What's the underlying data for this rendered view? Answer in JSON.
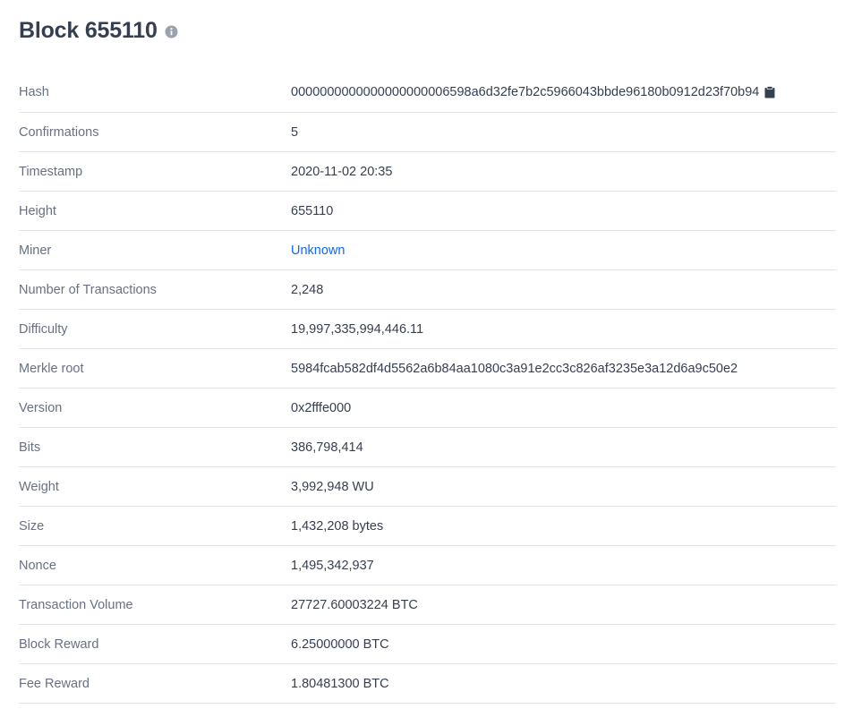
{
  "block": {
    "title": "Block 655110"
  },
  "details": [
    {
      "label": "Hash",
      "value": "0000000000000000000006598a6d32fe7b2c5966043bbde96180b0912d23f70b94"
    },
    {
      "label": "Confirmations",
      "value": "5"
    },
    {
      "label": "Timestamp",
      "value": "2020-11-02 20:35"
    },
    {
      "label": "Height",
      "value": "655110"
    },
    {
      "label": "Miner",
      "value": "Unknown"
    },
    {
      "label": "Number of Transactions",
      "value": "2,248"
    },
    {
      "label": "Difficulty",
      "value": "19,997,335,994,446.11"
    },
    {
      "label": "Merkle root",
      "value": "5984fcab582df4d5562a6b84aa1080c3a91e2cc3c826af3235e3a12d6a9c50e2"
    },
    {
      "label": "Version",
      "value": "0x2fffe000"
    },
    {
      "label": "Bits",
      "value": "386,798,414"
    },
    {
      "label": "Weight",
      "value": "3,992,948 WU"
    },
    {
      "label": "Size",
      "value": "1,432,208 bytes"
    },
    {
      "label": "Nonce",
      "value": "1,495,342,937"
    },
    {
      "label": "Transaction Volume",
      "value": "27727.60003224 BTC"
    },
    {
      "label": "Block Reward",
      "value": "6.25000000 BTC"
    },
    {
      "label": "Fee Reward",
      "value": "1.80481300 BTC"
    }
  ],
  "icons": {
    "info": "info-icon",
    "copy": "clipboard-icon"
  },
  "colors": {
    "title": "#353f52",
    "label": "#677184",
    "value": "#353f52",
    "link": "#0c6cf2",
    "divider": "#e2e4e8",
    "icon": "#9ba1ad"
  }
}
